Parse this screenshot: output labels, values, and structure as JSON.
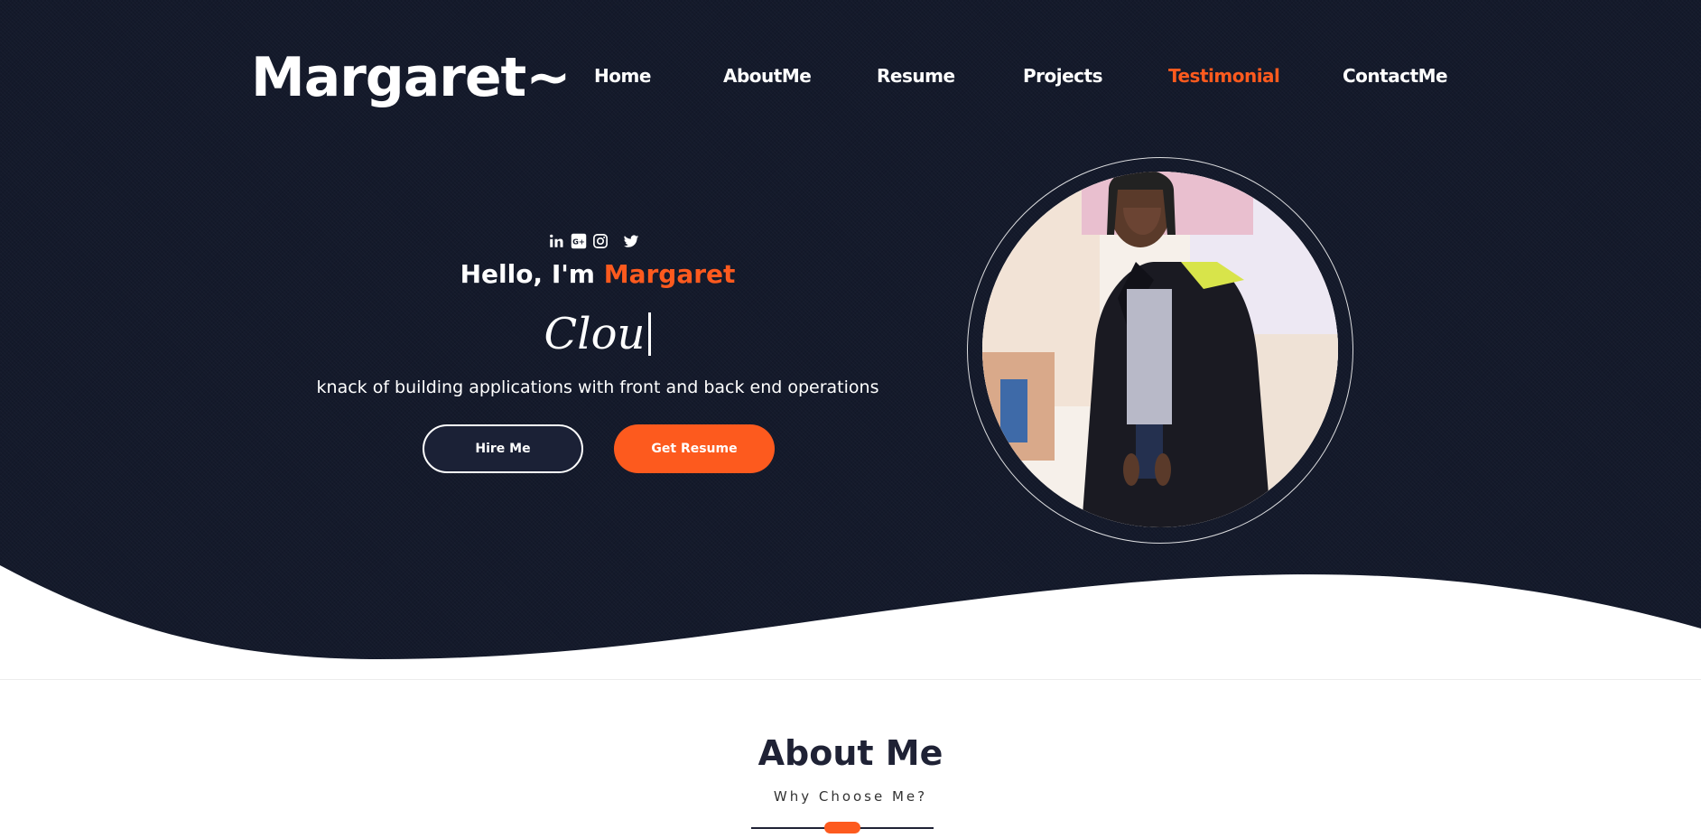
{
  "brand": {
    "logo_text": "Margaret~"
  },
  "nav": {
    "items": [
      {
        "label": "Home",
        "active": false
      },
      {
        "label": "AboutMe",
        "active": false
      },
      {
        "label": "Resume",
        "active": false
      },
      {
        "label": "Projects",
        "active": false
      },
      {
        "label": "Testimonial",
        "active": true
      },
      {
        "label": "ContactMe",
        "active": false
      }
    ]
  },
  "hero": {
    "social_icons": [
      "linkedin-icon",
      "google-plus-icon",
      "instagram-icon",
      "twitter-icon"
    ],
    "greeting_prefix": "Hello, I'm ",
    "greeting_name": "Margaret",
    "typed_text": "Clou",
    "tagline": "knack of building applications with front and back end operations",
    "hire_button": "Hire Me",
    "resume_button": "Get Resume",
    "portrait_alt": "portrait-photo"
  },
  "about": {
    "title": "About Me",
    "subtitle": "Why Choose Me?"
  },
  "colors": {
    "background": "#141a2b",
    "accent": "#fd5a1e",
    "text_light": "#ffffff",
    "text_dark": "#1f2235"
  }
}
